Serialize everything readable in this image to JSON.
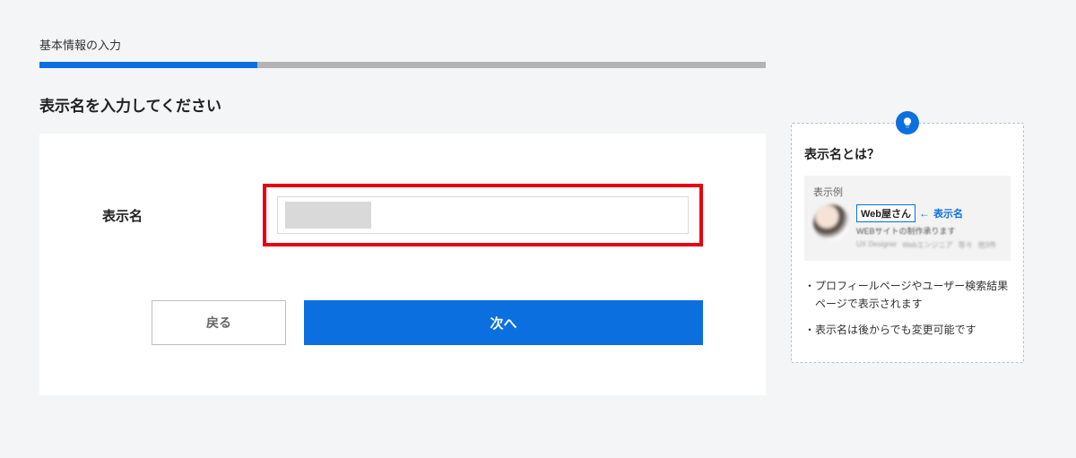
{
  "progress": {
    "step_label": "基本情報の入力",
    "percent": 30
  },
  "page": {
    "title": "表示名を入力してください"
  },
  "form": {
    "display_name": {
      "label": "表示名",
      "value": ""
    },
    "buttons": {
      "back": "戻る",
      "next": "次へ"
    }
  },
  "tip": {
    "icon_name": "lightbulb-icon",
    "title": "表示名とは？",
    "example": {
      "heading": "表示例",
      "sample_name": "Web屋さん",
      "pointer_label": "表示名",
      "desc": "WEBサイトの制作承ります",
      "tags": [
        "UX Designer",
        "Webエンジニア",
        "等々",
        "他3件"
      ]
    },
    "bullets": [
      "プロフィールページやユーザー検索結果ページで表示されます",
      "表示名は後からでも変更可能です"
    ]
  }
}
